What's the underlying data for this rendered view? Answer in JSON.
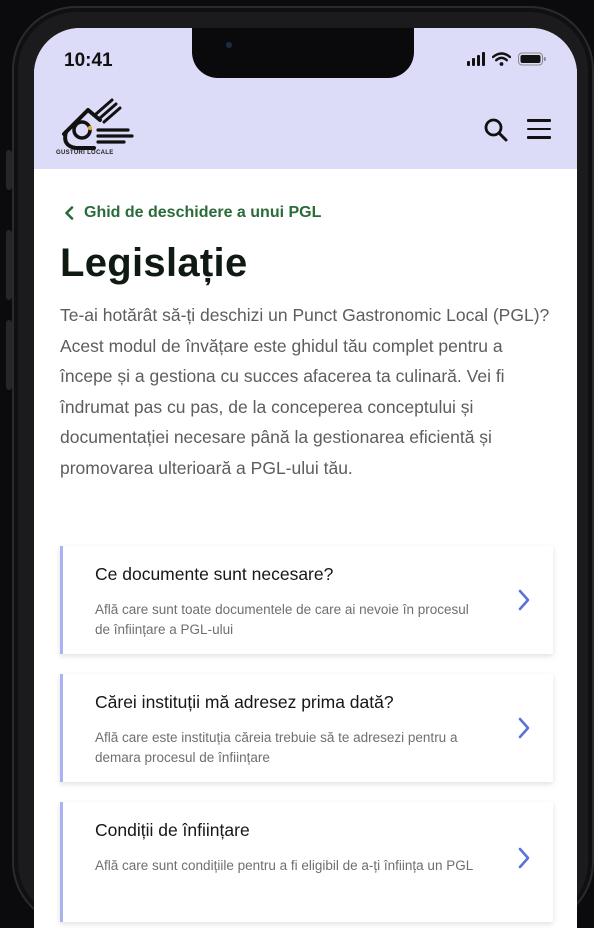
{
  "status_bar": {
    "time": "10:41"
  },
  "header": {
    "logo_text": "GUSTURI LOCALE"
  },
  "back_link": {
    "label": "Ghid de deschidere a unui PGL"
  },
  "page_title": "Legislație",
  "intro": "Te-ai hotărât să-ți deschizi un Punct Gastronomic Local (PGL)? Acest modul de învățare este ghidul tău complet pentru a începe și a gestiona cu succes afacerea ta culinară. Vei fi îndrumat pas cu pas, de la conceperea conceptului și documentației necesare până la gestionarea eficientă și promovarea ulterioară a PGL-ului tău.",
  "cards": [
    {
      "title": "Ce documente sunt necesare?",
      "description": "Află care sunt toate documentele de care ai nevoie în procesul de înființare a PGL-ului"
    },
    {
      "title": "Cărei instituții mă adresez prima dată?",
      "description": "Află care este instituția căreia trebuie să te adresezi pentru a demara procesul de înființare"
    },
    {
      "title": "Condiții de înființare",
      "description": "Află care sunt condițiile pentru a fi eligibil de a-ți înființa un PGL"
    }
  ],
  "colors": {
    "header_bg": "#dcdcf8",
    "accent_green": "#2a6b3a",
    "card_border": "#a9b3ee",
    "chevron": "#5b72d6"
  },
  "icons": [
    "back-chevron-icon",
    "search-icon",
    "menu-icon",
    "chevron-right-icon",
    "signal-icon",
    "wifi-icon",
    "battery-icon"
  ]
}
